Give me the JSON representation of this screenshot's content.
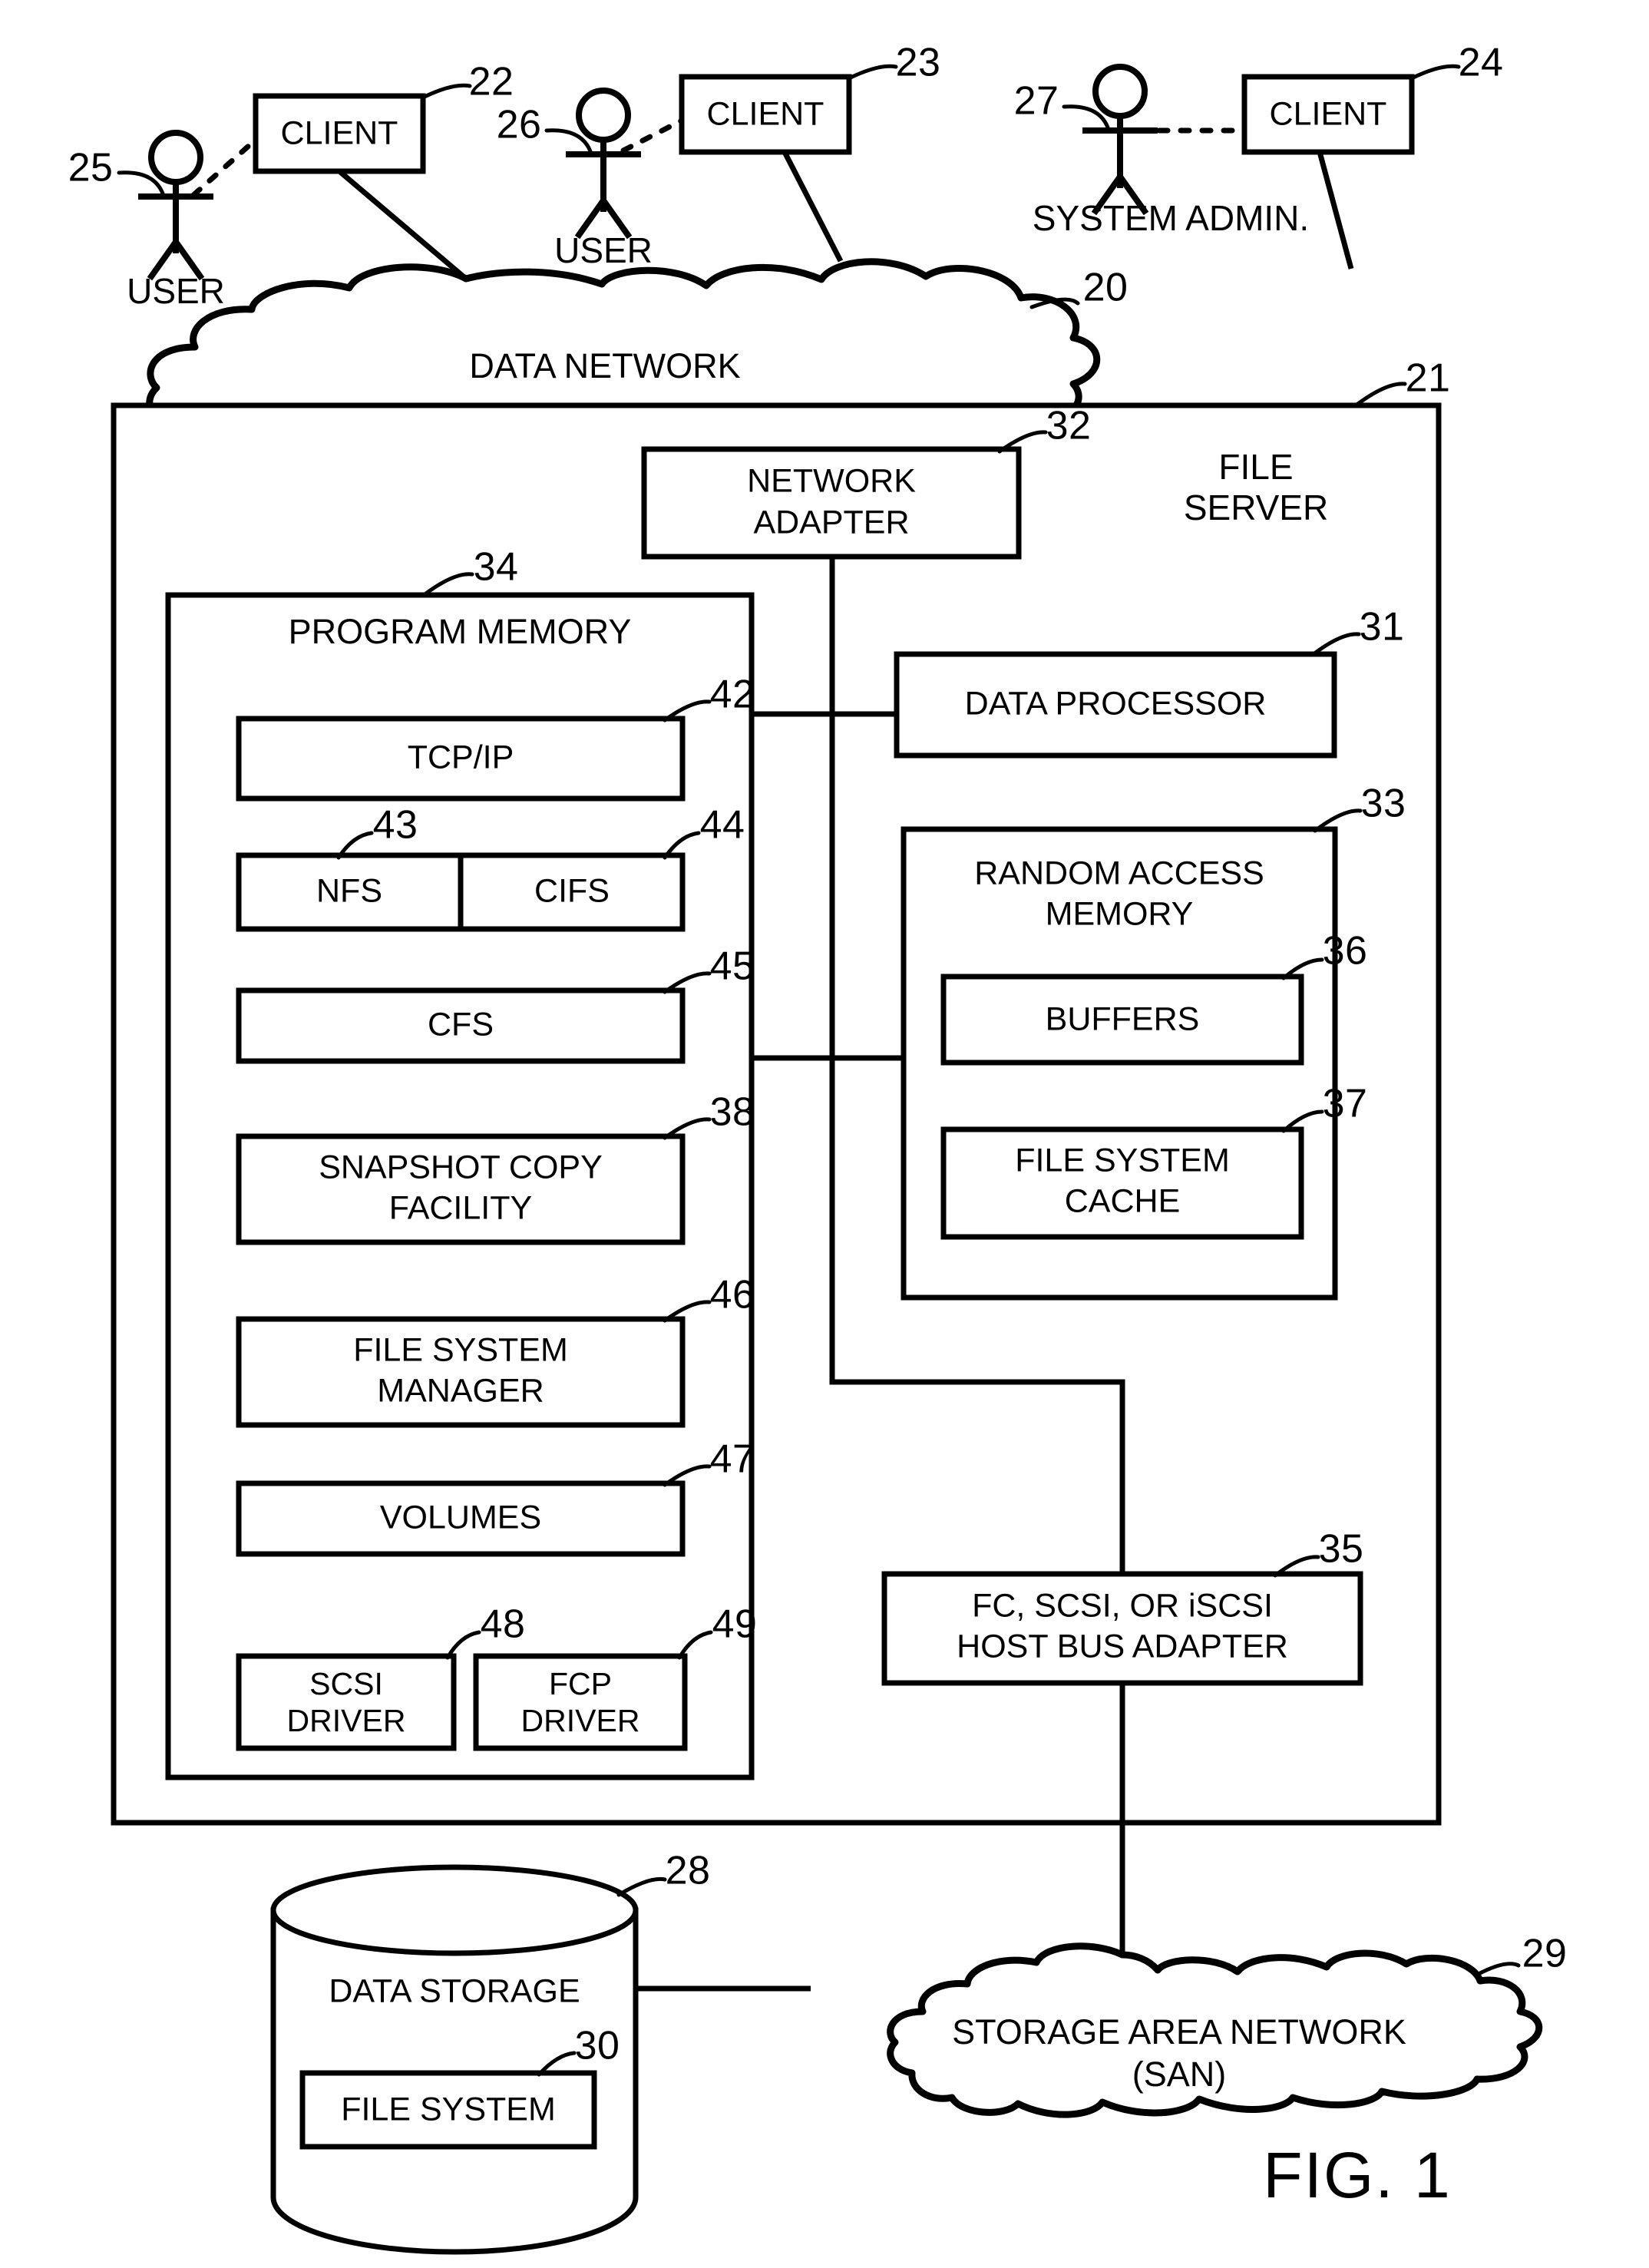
{
  "figure": {
    "label": "FIG. 1",
    "title": "File server network storage system block diagram"
  },
  "actors": [
    {
      "id": "user-left",
      "role_label": "USER",
      "ref": "25",
      "client_label": "CLIENT",
      "client_ref": "22"
    },
    {
      "id": "user-mid",
      "role_label": "USER",
      "ref": "26",
      "client_label": "CLIENT",
      "client_ref": "23"
    },
    {
      "id": "sysadmin",
      "role_label": "SYSTEM ADMIN.",
      "ref": "27",
      "client_label": "CLIENT",
      "client_ref": "24"
    }
  ],
  "networks": {
    "data_network": {
      "label": "DATA  NETWORK",
      "ref": "20"
    },
    "storage_area_network": {
      "label_line1": "STORAGE AREA NETWORK",
      "label_line2": "(SAN)",
      "ref": "29"
    }
  },
  "file_server": {
    "label_line1": "FILE",
    "label_line2": "SERVER",
    "ref": "21",
    "network_adapter": {
      "label_line1": "NETWORK",
      "label_line2": "ADAPTER",
      "ref": "32"
    },
    "data_processor": {
      "label": "DATA PROCESSOR",
      "ref": "31"
    },
    "random_access_memory": {
      "label_line1": "RANDOM ACCESS",
      "label_line2": "MEMORY",
      "ref": "33",
      "items": [
        {
          "label": "BUFFERS",
          "ref": "36"
        },
        {
          "label_line1": "FILE SYSTEM",
          "label_line2": "CACHE",
          "ref": "37"
        }
      ]
    },
    "host_bus_adapter": {
      "label_line1": "FC, SCSI, OR iSCSI",
      "label_line2": "HOST BUS ADAPTER",
      "ref": "35"
    },
    "program_memory": {
      "label": "PROGRAM MEMORY",
      "ref": "34",
      "modules": [
        {
          "label": "TCP/IP",
          "ref": "42"
        },
        {
          "label": "NFS",
          "ref": "43"
        },
        {
          "label": "CIFS",
          "ref": "44"
        },
        {
          "label": "CFS",
          "ref": "45"
        },
        {
          "label_line1": "SNAPSHOT COPY",
          "label_line2": "FACILITY",
          "ref": "38"
        },
        {
          "label_line1": "FILE SYSTEM",
          "label_line2": "MANAGER",
          "ref": "46"
        },
        {
          "label": "VOLUMES",
          "ref": "47"
        },
        {
          "label_line1": "SCSI",
          "label_line2": "DRIVER",
          "ref": "48"
        },
        {
          "label_line1": "FCP",
          "label_line2": "DRIVER",
          "ref": "49"
        }
      ]
    }
  },
  "data_storage": {
    "label": "DATA STORAGE",
    "ref": "28",
    "file_system": {
      "label": "FILE SYSTEM",
      "ref": "30"
    }
  },
  "colors": {
    "ink": "#000000",
    "paper": "#ffffff"
  }
}
